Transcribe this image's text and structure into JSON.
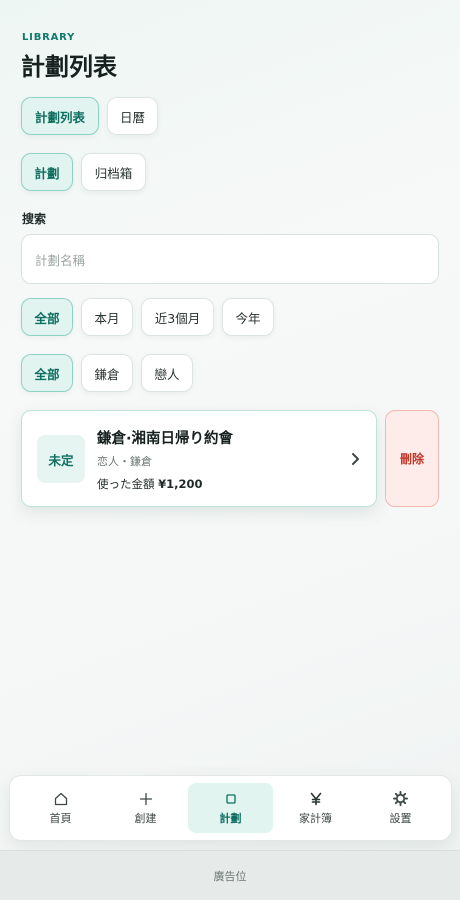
{
  "header": {
    "eyebrow": "LIBRARY",
    "title": "計劃列表"
  },
  "view_tabs": [
    {
      "label": "計劃列表",
      "active": true
    },
    {
      "label": "日曆",
      "active": false
    }
  ],
  "state_tabs": [
    {
      "label": "計劃",
      "active": true
    },
    {
      "label": "归档箱",
      "active": false
    }
  ],
  "search": {
    "label": "搜索",
    "placeholder": "計劃名稱"
  },
  "period_filters": [
    {
      "label": "全部",
      "active": true
    },
    {
      "label": "本月",
      "active": false
    },
    {
      "label": "近3個月",
      "active": false
    },
    {
      "label": "今年",
      "active": false
    }
  ],
  "place_filters": [
    {
      "label": "全部",
      "active": true
    },
    {
      "label": "鎌倉",
      "active": false
    },
    {
      "label": "戀人",
      "active": false
    }
  ],
  "plans": [
    {
      "status": "未定",
      "title": "鎌倉·湘南日帰り約會",
      "tags": "恋人・鎌倉",
      "spent_label": "使った金額",
      "spent_value": "¥1,200",
      "delete_label": "刪除"
    }
  ],
  "tabbar": [
    {
      "label": "首頁",
      "icon": "home-icon",
      "active": false
    },
    {
      "label": "創建",
      "icon": "plus-icon",
      "active": false
    },
    {
      "label": "計劃",
      "icon": "square-icon",
      "active": true
    },
    {
      "label": "家計簿",
      "icon": "yen-icon",
      "active": false
    },
    {
      "label": "設置",
      "icon": "gear-icon",
      "active": false
    }
  ],
  "ad": {
    "label": "廣告位"
  },
  "colors": {
    "accent": "#0d6e60",
    "accent_bg": "#e2f4f0",
    "danger": "#c0392b",
    "danger_bg": "#fdecea"
  }
}
